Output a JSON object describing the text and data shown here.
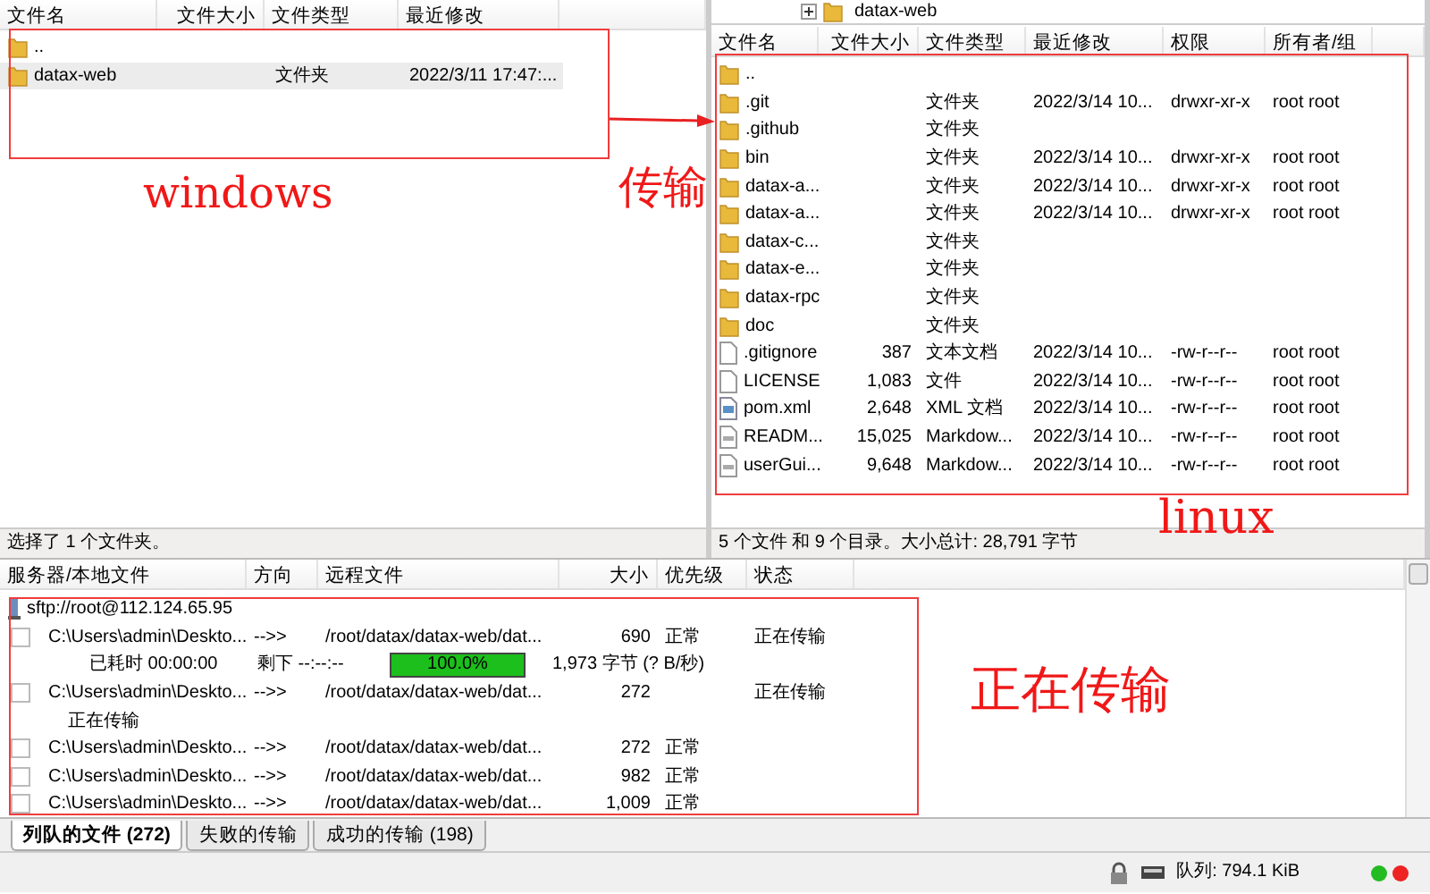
{
  "local_pane": {
    "columns": [
      "文件名",
      "文件大小",
      "文件类型",
      "最近修改"
    ],
    "rows": [
      {
        "kind": "folder",
        "name": "..",
        "selected": false
      },
      {
        "kind": "folder",
        "name": "datax-web",
        "type": "文件夹",
        "modified": "2022/3/11 17:47:...",
        "selected": true
      }
    ],
    "status": "选择了 1 个文件夹。"
  },
  "remote_pane": {
    "tree_item": "datax-web",
    "columns": [
      "文件名",
      "文件大小",
      "文件类型",
      "最近修改",
      "权限",
      "所有者/组"
    ],
    "rows": [
      {
        "kind": "folder",
        "name": ".."
      },
      {
        "kind": "folder",
        "name": ".git",
        "type": "文件夹",
        "modified": "2022/3/14 10...",
        "permissions": "drwxr-xr-x",
        "owner": "root root"
      },
      {
        "kind": "folder",
        "name": ".github",
        "type": "文件夹"
      },
      {
        "kind": "folder",
        "name": "bin",
        "type": "文件夹",
        "modified": "2022/3/14 10...",
        "permissions": "drwxr-xr-x",
        "owner": "root root"
      },
      {
        "kind": "folder",
        "name": "datax-a...",
        "type": "文件夹",
        "modified": "2022/3/14 10...",
        "permissions": "drwxr-xr-x",
        "owner": "root root"
      },
      {
        "kind": "folder",
        "name": "datax-a...",
        "type": "文件夹",
        "modified": "2022/3/14 10...",
        "permissions": "drwxr-xr-x",
        "owner": "root root"
      },
      {
        "kind": "folder",
        "name": "datax-c...",
        "type": "文件夹"
      },
      {
        "kind": "folder",
        "name": "datax-e...",
        "type": "文件夹"
      },
      {
        "kind": "folder",
        "name": "datax-rpc",
        "type": "文件夹"
      },
      {
        "kind": "folder",
        "name": "doc",
        "type": "文件夹"
      },
      {
        "kind": "file",
        "name": ".gitignore",
        "size": "387",
        "type": "文本文档",
        "modified": "2022/3/14 10...",
        "permissions": "-rw-r--r--",
        "owner": "root root"
      },
      {
        "kind": "file",
        "name": "LICENSE",
        "size": "1,083",
        "type": "文件",
        "modified": "2022/3/14 10...",
        "permissions": "-rw-r--r--",
        "owner": "root root"
      },
      {
        "kind": "xml",
        "name": "pom.xml",
        "size": "2,648",
        "type": "XML 文档",
        "modified": "2022/3/14 10...",
        "permissions": "-rw-r--r--",
        "owner": "root root"
      },
      {
        "kind": "md",
        "name": "READM...",
        "size": "15,025",
        "type": "Markdow...",
        "modified": "2022/3/14 10...",
        "permissions": "-rw-r--r--",
        "owner": "root root"
      },
      {
        "kind": "md",
        "name": "userGui...",
        "size": "9,648",
        "type": "Markdow...",
        "modified": "2022/3/14 10...",
        "permissions": "-rw-r--r--",
        "owner": "root root"
      }
    ],
    "status": "5 个文件 和 9 个目录。大小总计: 28,791 字节"
  },
  "queue": {
    "columns": [
      "服务器/本地文件",
      "方向",
      "远程文件",
      "大小",
      "优先级",
      "状态"
    ],
    "items": [
      {
        "kind": "server",
        "label": "sftp://root@112.124.65.95"
      },
      {
        "kind": "transfer",
        "local": "C:\\Users\\admin\\Deskto...",
        "direction": "-->>",
        "remote": "/root/datax/datax-web/dat...",
        "size": "690",
        "checked": false,
        "priority": "正常",
        "status": "正在传输"
      },
      {
        "kind": "progress",
        "elapsed": "已耗时 00:00:00",
        "remaining": "剩下 --:--:--",
        "level": 1.0,
        "percent": "100.0%",
        "rate": "1,973 字节 (? B/秒)"
      },
      {
        "kind": "transfer",
        "local": "C:\\Users\\admin\\Deskto...",
        "direction": "-->>",
        "remote": "/root/datax/datax-web/dat...",
        "size": "272",
        "checked": false,
        "status": "正在传输"
      },
      {
        "kind": "note",
        "label": "正在传输"
      },
      {
        "kind": "transfer",
        "local": "C:\\Users\\admin\\Deskto...",
        "direction": "-->>",
        "remote": "/root/datax/datax-web/dat...",
        "size": "272",
        "checked": false,
        "priority": "正常"
      },
      {
        "kind": "transfer",
        "local": "C:\\Users\\admin\\Deskto...",
        "direction": "-->>",
        "remote": "/root/datax/datax-web/dat...",
        "size": "982",
        "checked": false,
        "priority": "正常"
      },
      {
        "kind": "transfer",
        "local": "C:\\Users\\admin\\Deskto...",
        "direction": "-->>",
        "remote": "/root/datax/datax-web/dat...",
        "size": "1,009",
        "checked": false,
        "priority": "正常"
      }
    ]
  },
  "tabs": [
    {
      "label": "列队的文件 (272)",
      "selected": true
    },
    {
      "label": "失败的传输",
      "selected": false
    },
    {
      "label": "成功的传输 (198)",
      "selected": false
    }
  ],
  "status_bar": {
    "queue": "队列: 794.1 KiB",
    "lights": [
      {
        "color": "#22bb22"
      },
      {
        "color": "#ee2222"
      }
    ]
  },
  "annotations": [
    "windows",
    "传输",
    "linux",
    "正在传输"
  ]
}
